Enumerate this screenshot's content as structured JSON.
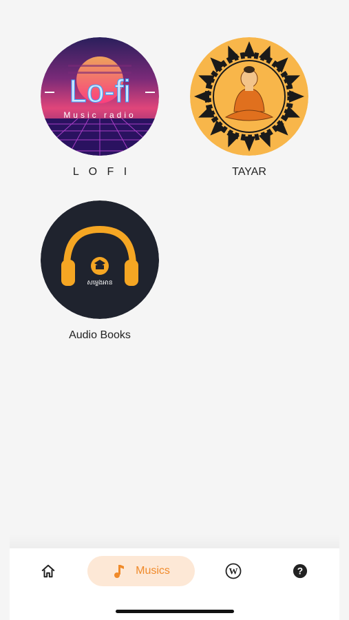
{
  "stations": [
    {
      "label": "L O F I",
      "art": {
        "title": "Lo-fi",
        "subtitle": "Music radio"
      }
    },
    {
      "label": "TAYAR"
    },
    {
      "label": "Audio Books",
      "art": {
        "caption": "សម្លេងអាន"
      }
    }
  ],
  "bottom_nav": {
    "items": [
      {
        "icon": "home-icon"
      },
      {
        "icon": "music-note-icon",
        "label": "Musics",
        "active": true
      },
      {
        "icon": "wordpress-icon"
      },
      {
        "icon": "help-icon"
      }
    ],
    "accent_color": "#f08a2a",
    "active_bg": "#fde8d6"
  }
}
